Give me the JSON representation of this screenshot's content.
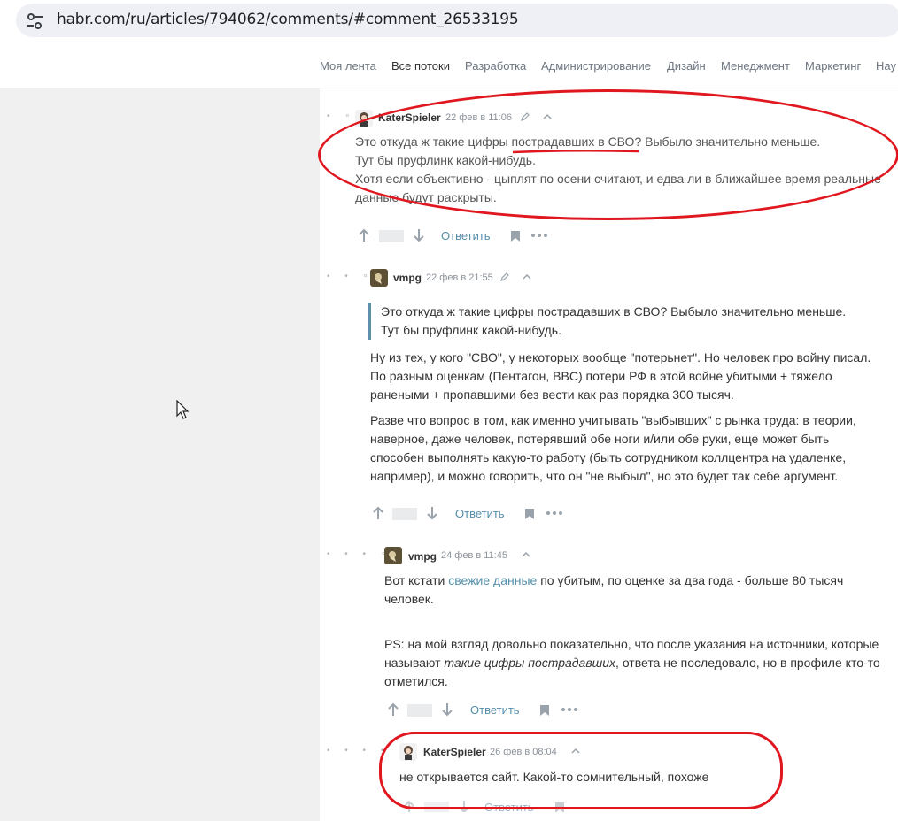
{
  "browser": {
    "url": "habr.com/ru/articles/794062/comments/#comment_26533195"
  },
  "nav": {
    "items": [
      {
        "label": "Моя лента"
      },
      {
        "label": "Все потоки"
      },
      {
        "label": "Разработка"
      },
      {
        "label": "Администрирование"
      },
      {
        "label": "Дизайн"
      },
      {
        "label": "Менеджмент"
      },
      {
        "label": "Маркетинг"
      },
      {
        "label": "Нау"
      }
    ],
    "active_index": 1
  },
  "comments": [
    {
      "author": "KaterSpieler",
      "date": "22 фев в 11:06",
      "paragraphs": [
        "Это откуда ж такие цифры пострадавших в СВО? Выбыло значительно меньше.",
        "Тут бы пруфлинк какой-нибудь.",
        "Хотя если объективно - цыплят по осени считают, и едва ли в ближайшее время реальные",
        "данные будут раскрыты."
      ],
      "reply_label": "Ответить",
      "highlighted": true
    },
    {
      "author": "vmpg",
      "date": "22 фев в 21:55",
      "quote": [
        "Это откуда ж такие цифры пострадавших в СВО? Выбыло значительно меньше.",
        "Тут бы пруфлинк какой-нибудь."
      ],
      "paragraph1": [
        "Ну из тех, у кого \"СВО\", у некоторых вообще \"потерьнет\". Но человек про войну писал.",
        "По разным оценкам (Пентагон, BBC) потери РФ в этой войне убитыми + тяжело",
        "ранеными + пропавшими без вести как раз порядка 300 тысяч."
      ],
      "paragraph2": [
        "Разве что вопрос в том, как именно учитывать \"выбывших\" с рынка труда: в теории,",
        "наверное, даже человек, потерявший обе ноги и/или обе руки, еще может быть",
        "способен выполнять какую-то работу (быть сотрудником коллцентра на удаленке,",
        "например), и можно говорить, что он \"не выбыл\", но это будет так себе аргумент."
      ],
      "reply_label": "Ответить"
    },
    {
      "author": "vmpg",
      "date": "24 фев в 11:45",
      "text1_before": "Вот кстати ",
      "text1_link": "свежие данные",
      "text1_after": " по убитым, по оценке за два года - больше 80 тысяч",
      "text1_line2": "человек.",
      "ps_line1": "PS: на мой взгляд довольно показательно, что после указания на источники, которые",
      "ps_line2_before": "называют ",
      "ps_line2_italic": "такие цифры пострадавших",
      "ps_line2_after": ", ответа не последовало, но в профиле кто-то",
      "ps_line3": "отметился.",
      "reply_label": "Ответить"
    },
    {
      "author": "KaterSpieler",
      "date": "26 фев в 08:04",
      "text": "не открывается сайт. Какой-то сомнительный, похоже",
      "reply_label": "Ответить",
      "highlighted": true
    }
  ],
  "colors": {
    "annotation_red": "#e0171f",
    "link_blue": "#548eaa",
    "quote_bar": "#5e8fa8"
  }
}
